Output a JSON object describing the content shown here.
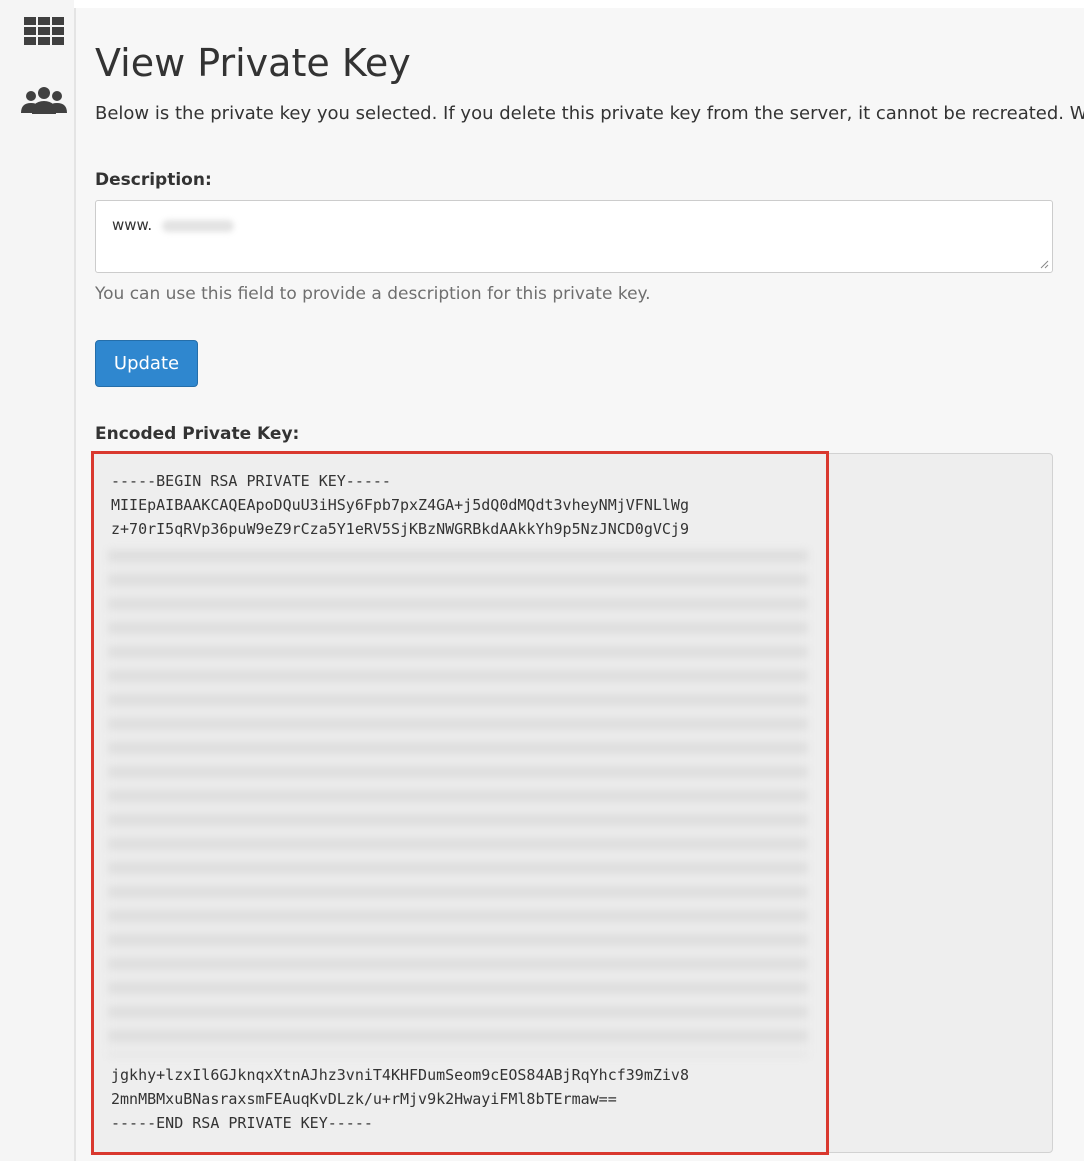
{
  "sidebar": {
    "icons": [
      "grid-icon",
      "users-icon"
    ]
  },
  "page": {
    "title": "View Private Key",
    "intro": "Below is the private key you selected. If you delete this private key from the server, it cannot be recreated. We r"
  },
  "description": {
    "label": "Description:",
    "value": "www.",
    "help": "You can use this field to provide a description for this private key."
  },
  "actions": {
    "update_label": "Update"
  },
  "private_key": {
    "label": "Encoded Private Key:",
    "visible_head": [
      "-----BEGIN RSA PRIVATE KEY-----",
      "MIIEpAIBAAKCAQEApoDQuU3iHSy6Fpb7pxZ4GA+j5dQ0dMQdt3vheyNMjVFNLlWg",
      "z+70rI5qRVp36puW9eZ9rCza5Y1eRV5SjKBzNWGRBkdAAkkYh9p5NzJNCD0gVCj9"
    ],
    "visible_tail": [
      "jgkhy+lzxIl6GJknqxXtnAJhz3vniT4KHFDumSeom9cEOS84ABjRqYhcf39mZiv8",
      "2mnMBMxuBNasraxsmFEAuqKvDLzk/u+rMjv9k2HwayiFMl8bTErmaw==",
      "-----END RSA PRIVATE KEY-----"
    ]
  },
  "colors": {
    "accent": "#2f87cf",
    "highlight_border": "#d9382e"
  }
}
